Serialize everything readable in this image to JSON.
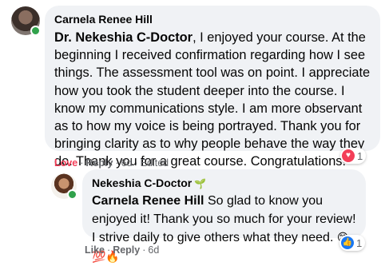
{
  "comment": {
    "author": "Carnela Renee Hill",
    "mention": "Dr. Nekeshia C-Doctor",
    "body": ", I enjoyed your course. At the beginning I received confirmation regarding how I see things. The assessment tool was on point. I appreciate how you took the student deeper into the course. I know my communications style. I am more observant as to how my voice is being portrayed. Thank you for bringing clarity as to why people behave the way they do. Thank you for a great course. Congratulations!",
    "actions": {
      "reaction": "Love",
      "reply": "Reply",
      "time": "6d",
      "edited": "Edited"
    },
    "reaction_icon": "heart-icon",
    "reaction_count": "1",
    "reaction_color": "#f33e58"
  },
  "reply": {
    "author": "Nekeshia C-Doctor",
    "author_badge_icon": "sprout-icon",
    "mention": "Carnela Renee Hill",
    "body": " So glad to know you enjoyed it! Thank you so much for your review! I strive daily to give others what they need. ",
    "emojis": "😊💯🔥",
    "actions": {
      "like": "Like",
      "reply": "Reply",
      "time": "6d"
    },
    "reaction_icon": "like-icon",
    "reaction_count": "1",
    "reaction_color": "#1877f2"
  },
  "colors": {
    "bubble": "#f0f2f5",
    "meta_text": "#65676b",
    "online": "#31a24c"
  }
}
